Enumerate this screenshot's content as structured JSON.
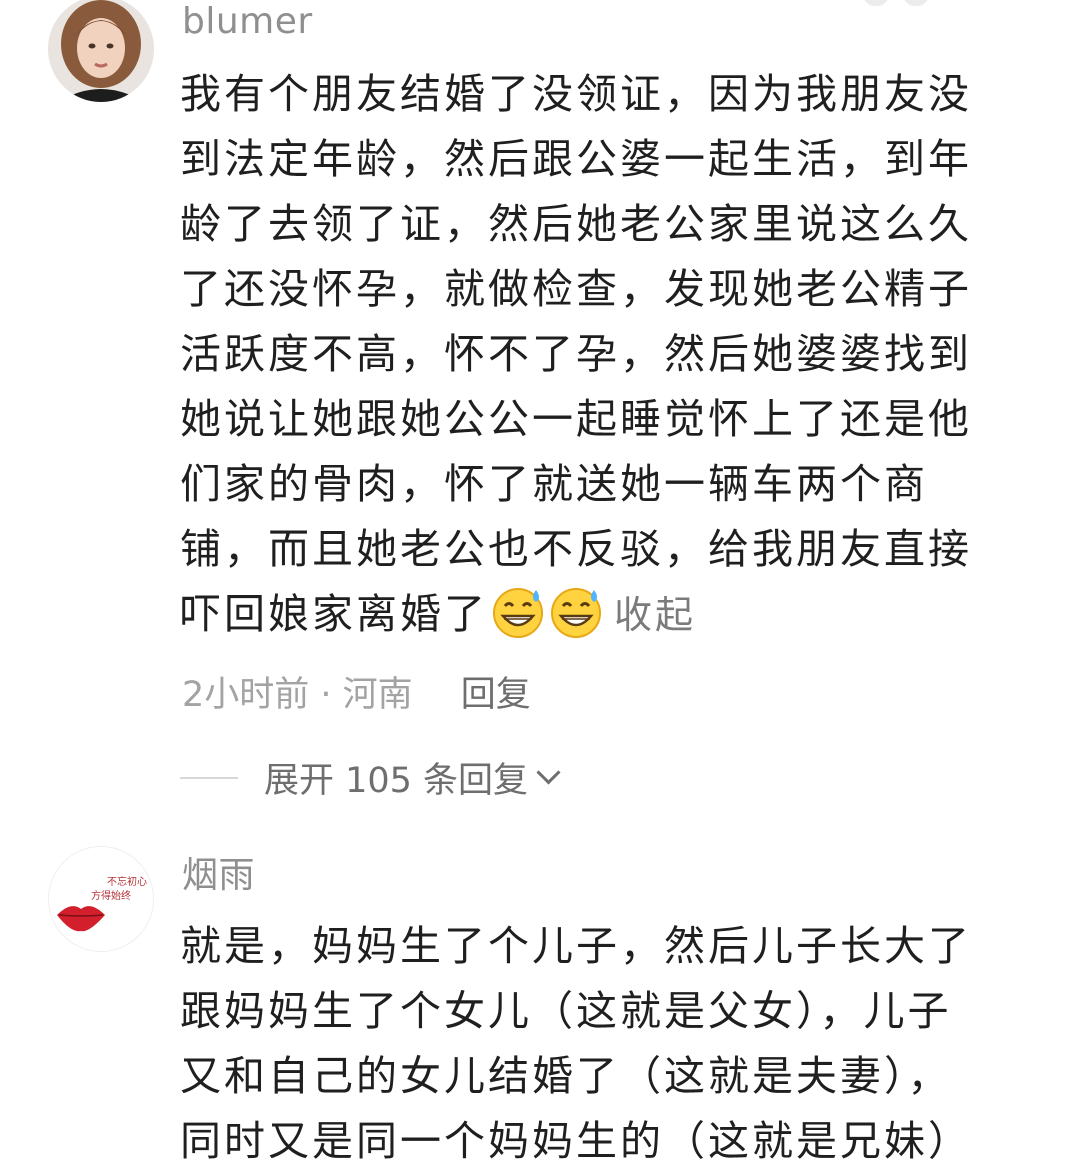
{
  "comments": [
    {
      "username": "blumer",
      "lines": [
        "我有个朋友结婚了没领证，因为我朋友没",
        "到法定年龄，然后跟公婆一起生活，到年",
        "龄了去领了证，然后她老公家里说这么久",
        "了还没怀孕，就做检查，发现她老公精子",
        "活跃度不高，怀不了孕，然后她婆婆找到",
        "她说让她跟她公公一起睡觉怀上了还是他",
        "们家的骨肉，怀了就送她一辆车两个商",
        "铺，而且她老公也不反驳，给我朋友直接",
        "吓回娘家离婚了"
      ],
      "emojis": [
        "grin-sweat-icon",
        "grin-sweat-icon"
      ],
      "collapse_label": "收起",
      "time": "2小时前",
      "separator": " · ",
      "location": "河南",
      "reply_label": "回复",
      "expand_label": "展开 105 条回复"
    },
    {
      "username": "烟雨",
      "avatar_text_1": "不忘初心",
      "avatar_text_2": "方得始终",
      "lines": [
        "就是，妈妈生了个儿子，然后儿子长大了",
        "跟妈妈生了个女儿（这就是父女），儿子",
        "又和自己的女儿结婚了（这就是夫妻），",
        "同时又是同一个妈妈生的（这就是兄妹）"
      ]
    }
  ],
  "colors": {
    "text": "#1f1f1f",
    "username": "#8f8f8f",
    "meta": "#a3a3a3",
    "link": "#6e6e6e"
  }
}
